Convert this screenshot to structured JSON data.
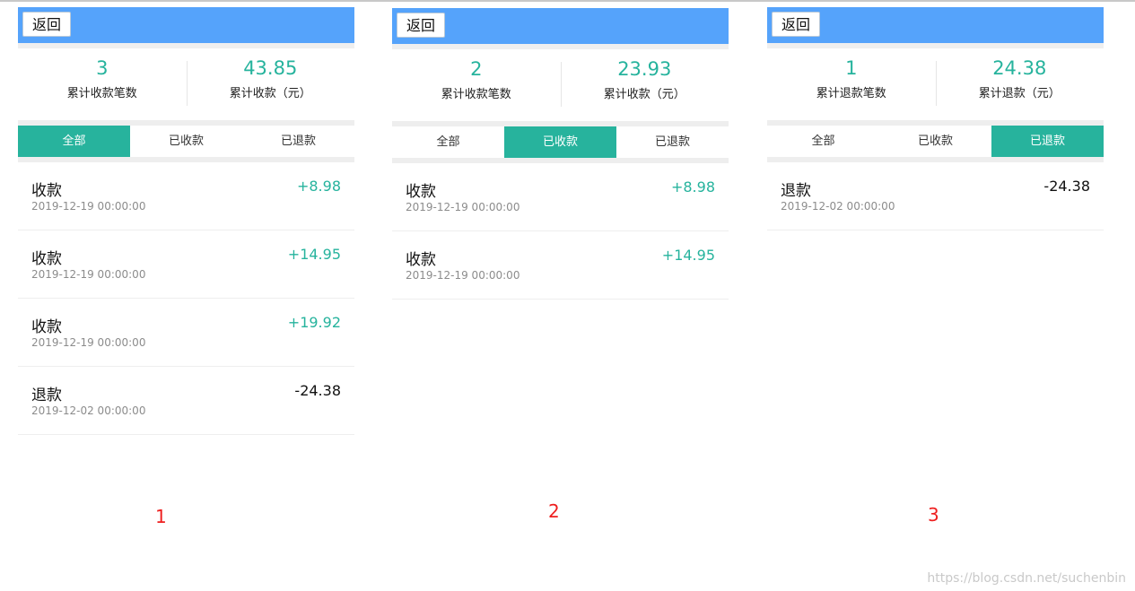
{
  "panels": [
    {
      "back_label": "返回",
      "stats": [
        {
          "value": "3",
          "label": "累计收款笔数"
        },
        {
          "value": "43.85",
          "label": "累计收款（元）"
        }
      ],
      "tabs": [
        {
          "label": "全部",
          "active": true
        },
        {
          "label": "已收款",
          "active": false
        },
        {
          "label": "已退款",
          "active": false
        }
      ],
      "records": [
        {
          "type": "收款",
          "date": "2019-12-19 00:00:00",
          "amount": "+8.98",
          "positive": true
        },
        {
          "type": "收款",
          "date": "2019-12-19 00:00:00",
          "amount": "+14.95",
          "positive": true
        },
        {
          "type": "收款",
          "date": "2019-12-19 00:00:00",
          "amount": "+19.92",
          "positive": true
        },
        {
          "type": "退款",
          "date": "2019-12-02 00:00:00",
          "amount": "-24.38",
          "positive": false
        }
      ],
      "caption": "1"
    },
    {
      "back_label": "返回",
      "stats": [
        {
          "value": "2",
          "label": "累计收款笔数"
        },
        {
          "value": "23.93",
          "label": "累计收款（元）"
        }
      ],
      "tabs": [
        {
          "label": "全部",
          "active": false
        },
        {
          "label": "已收款",
          "active": true
        },
        {
          "label": "已退款",
          "active": false
        }
      ],
      "records": [
        {
          "type": "收款",
          "date": "2019-12-19 00:00:00",
          "amount": "+8.98",
          "positive": true
        },
        {
          "type": "收款",
          "date": "2019-12-19 00:00:00",
          "amount": "+14.95",
          "positive": true
        }
      ],
      "caption": "2"
    },
    {
      "back_label": "返回",
      "stats": [
        {
          "value": "1",
          "label": "累计退款笔数"
        },
        {
          "value": "24.38",
          "label": "累计退款（元）"
        }
      ],
      "tabs": [
        {
          "label": "全部",
          "active": false
        },
        {
          "label": "已收款",
          "active": false
        },
        {
          "label": "已退款",
          "active": true
        }
      ],
      "records": [
        {
          "type": "退款",
          "date": "2019-12-02 00:00:00",
          "amount": "-24.38",
          "positive": false
        }
      ],
      "caption": "3"
    }
  ],
  "watermark": "https://blog.csdn.net/suchenbin",
  "colors": {
    "header": "#55a3fb",
    "accent": "#27b39d",
    "caption": "#ee1f1f"
  }
}
